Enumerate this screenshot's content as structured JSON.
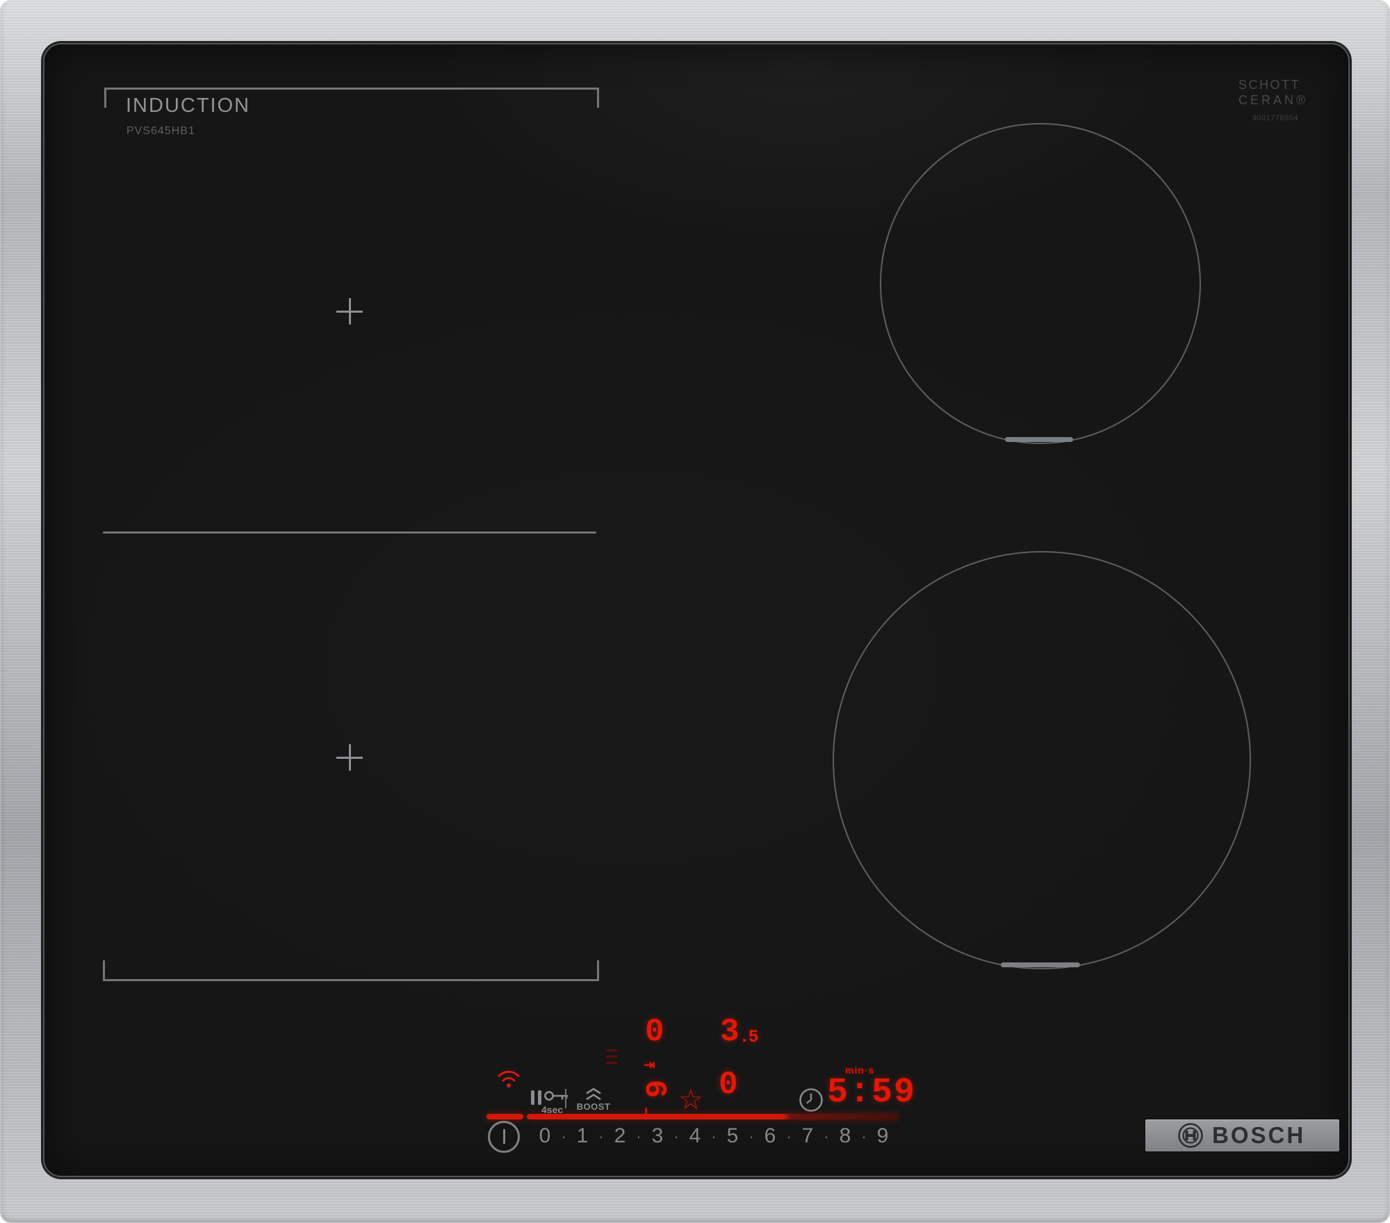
{
  "device": {
    "type_label": "INDUCTION",
    "model": "PVS645HB1",
    "glass_brand_line1": "SCHOTT",
    "glass_brand_line2": "CERAN®",
    "glass_code": "9001778554",
    "maker_logo": "BOSCH"
  },
  "panel": {
    "lock_hint": "4sec",
    "boost_label": "BOOST",
    "timer": {
      "unit_label": "min·s",
      "value": "5:59"
    },
    "displays": {
      "rear_left_level": "0",
      "rear_right_level_main": "3",
      "rear_right_level_decimal": ".5",
      "front_left_level": "6",
      "front_right_level": "0"
    },
    "glyphs": {
      "star": "☆",
      "move_pan_arrow": "⇥"
    },
    "slider": {
      "dot": "·",
      "levels": [
        "0",
        "1",
        "2",
        "3",
        "4",
        "5",
        "6",
        "7",
        "8",
        "9"
      ]
    }
  },
  "colors": {
    "led_red": "#e21708",
    "dim_red": "#5a100b",
    "icon_gray": "#8b8e91",
    "ring_gray": "#5c5f63",
    "glass_black": "#161616",
    "steel": "#b7babd"
  }
}
